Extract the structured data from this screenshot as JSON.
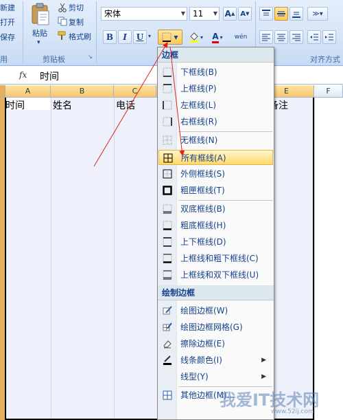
{
  "ribbon": {
    "clipboard": {
      "new_label": "新建",
      "open_label": "打开",
      "save_label": "保存",
      "paste_label": "粘贴",
      "cut_label": "剪切",
      "copy_label": "复制",
      "format_painter_label": "格式刷",
      "group_label": "剪贴板",
      "left_group_label": "用"
    },
    "font": {
      "font_name": "宋体",
      "font_size": "11",
      "bold": "B",
      "italic": "I",
      "underline": "U",
      "grow": "A",
      "shrink": "A",
      "font_color": "A",
      "phonetic": "wén"
    },
    "alignment": {
      "group_label": "对齐方式"
    }
  },
  "formula_bar": {
    "fx_label": "fx",
    "value": "时间"
  },
  "columns": [
    "A",
    "B",
    "C",
    "D",
    "E",
    "F"
  ],
  "cells": {
    "a1": "时间",
    "b1": "姓名",
    "c1": "电话",
    "e1": "备注"
  },
  "menu": {
    "header_borders": "边框",
    "items": [
      {
        "label": "下框线(B)",
        "icon": "bottom-border-icon"
      },
      {
        "label": "上框线(P)",
        "icon": "top-border-icon"
      },
      {
        "label": "左框线(L)",
        "icon": "left-border-icon"
      },
      {
        "label": "右框线(R)",
        "icon": "right-border-icon"
      },
      {
        "label": "无框线(N)",
        "icon": "no-border-icon"
      },
      {
        "label": "所有框线(A)",
        "icon": "all-borders-icon"
      },
      {
        "label": "外侧框线(S)",
        "icon": "outside-borders-icon"
      },
      {
        "label": "粗匣框线(T)",
        "icon": "thick-box-border-icon"
      },
      {
        "label": "双底框线(B)",
        "icon": "double-bottom-border-icon"
      },
      {
        "label": "粗底框线(H)",
        "icon": "thick-bottom-border-icon"
      },
      {
        "label": "上下框线(D)",
        "icon": "top-bottom-border-icon"
      },
      {
        "label": "上框线和粗下框线(C)",
        "icon": "top-thick-bottom-border-icon"
      },
      {
        "label": "上框线和双下框线(U)",
        "icon": "top-double-bottom-border-icon"
      }
    ],
    "header_draw": "绘制边框",
    "draw_items": [
      {
        "label": "绘图边框(W)",
        "icon": "draw-border-icon"
      },
      {
        "label": "绘图边框网格(G)",
        "icon": "draw-border-grid-icon"
      },
      {
        "label": "擦除边框(E)",
        "icon": "erase-border-icon"
      },
      {
        "label": "线条颜色(I)",
        "icon": "line-color-icon"
      },
      {
        "label": "线型(Y)",
        "icon": ""
      },
      {
        "label": "其他边框(M)...",
        "icon": "more-borders-icon"
      }
    ]
  },
  "watermark": {
    "text": "我爱IT技术网",
    "url": "www.52ij.com"
  },
  "colors": {
    "ribbon_bg": "#d5e4f7",
    "highlight": "#ffd96b",
    "arrow": "#e02020"
  }
}
